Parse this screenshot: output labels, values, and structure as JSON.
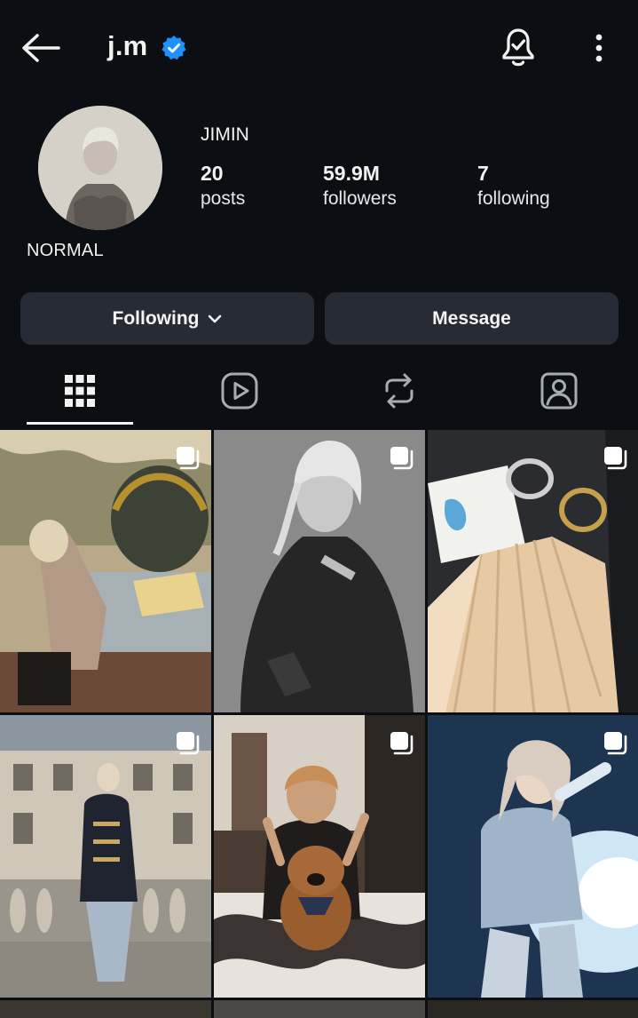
{
  "header": {
    "username": "j.m",
    "icons": {
      "back": "back-arrow-icon",
      "verified": "verified-badge-icon",
      "notifications": "bell-check-icon",
      "more": "more-vertical-icon"
    }
  },
  "profile": {
    "display_name": "JIMIN",
    "stats": [
      {
        "value": "20",
        "label": "posts"
      },
      {
        "value": "59.9M",
        "label": "followers"
      },
      {
        "value": "7",
        "label": "following"
      }
    ],
    "bio": "NORMAL"
  },
  "actions": {
    "following_label": "Following",
    "message_label": "Message"
  },
  "tabs": [
    {
      "icon": "grid-icon",
      "selected": true
    },
    {
      "icon": "reels-icon",
      "selected": false
    },
    {
      "icon": "reposts-icon",
      "selected": false
    },
    {
      "icon": "tagged-icon",
      "selected": false
    }
  ],
  "posts_icon": "multiple-photos-icon",
  "colors": {
    "background": "#0b0f14",
    "button": "#272b33",
    "verified": "#1e90ff",
    "text": "#f2f2f2"
  }
}
